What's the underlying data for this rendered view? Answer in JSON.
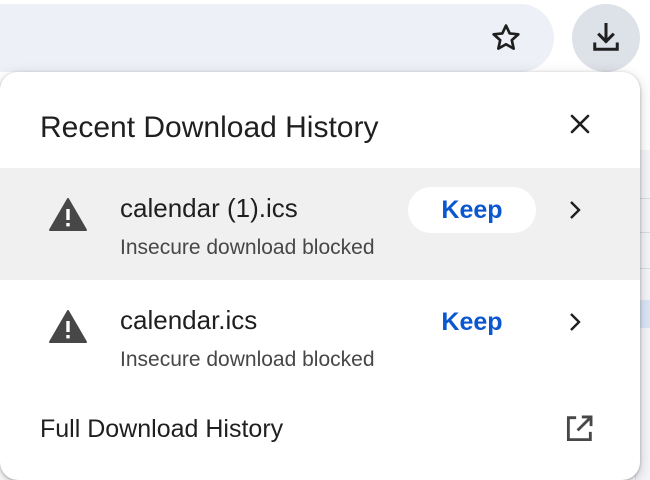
{
  "toolbar": {
    "bookmark_icon": "star-outline-icon",
    "download_icon": "download-icon"
  },
  "panel": {
    "title": "Recent Download History",
    "close_icon": "close-icon"
  },
  "downloads": [
    {
      "filename": "calendar (1).ics",
      "status": "Insecure download blocked",
      "action_label": "Keep",
      "selected": true
    },
    {
      "filename": "calendar.ics",
      "status": "Insecure download blocked",
      "action_label": "Keep",
      "selected": false
    }
  ],
  "footer": {
    "label": "Full Download History",
    "icon": "open-in-new-icon"
  },
  "colors": {
    "accent": "#0b57d0",
    "selected_row": "#f0f0f0",
    "text": "#1f1f1f",
    "secondary_text": "#474747",
    "warning_icon": "#474747"
  }
}
